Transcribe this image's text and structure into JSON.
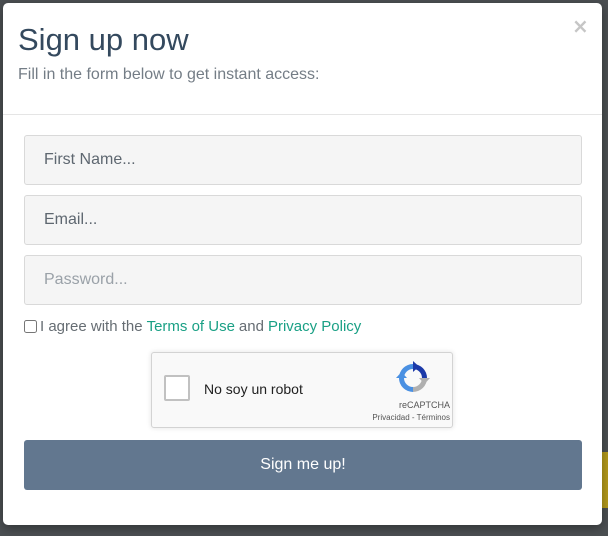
{
  "modal": {
    "title": "Sign up now",
    "subtitle": "Fill in the form below to get instant access:",
    "close_label": "×"
  },
  "form": {
    "first_name_placeholder": "First Name...",
    "email_placeholder": "Email...",
    "password_placeholder": "Password...",
    "agree_prefix": "I agree with the",
    "terms_link": "Terms of Use",
    "agree_and": "and",
    "privacy_link": "Privacy Policy",
    "agree_checked": false
  },
  "recaptcha": {
    "label": "No soy un robot",
    "brand": "reCAPTCHA",
    "links": "Privacidad - Términos",
    "icon": "recaptcha-logo-icon"
  },
  "submit": {
    "label": "Sign me up!"
  },
  "colors": {
    "title": "#34495e",
    "link": "#1aa085",
    "button": "#62778f",
    "backdrop": "#4b4f52"
  }
}
